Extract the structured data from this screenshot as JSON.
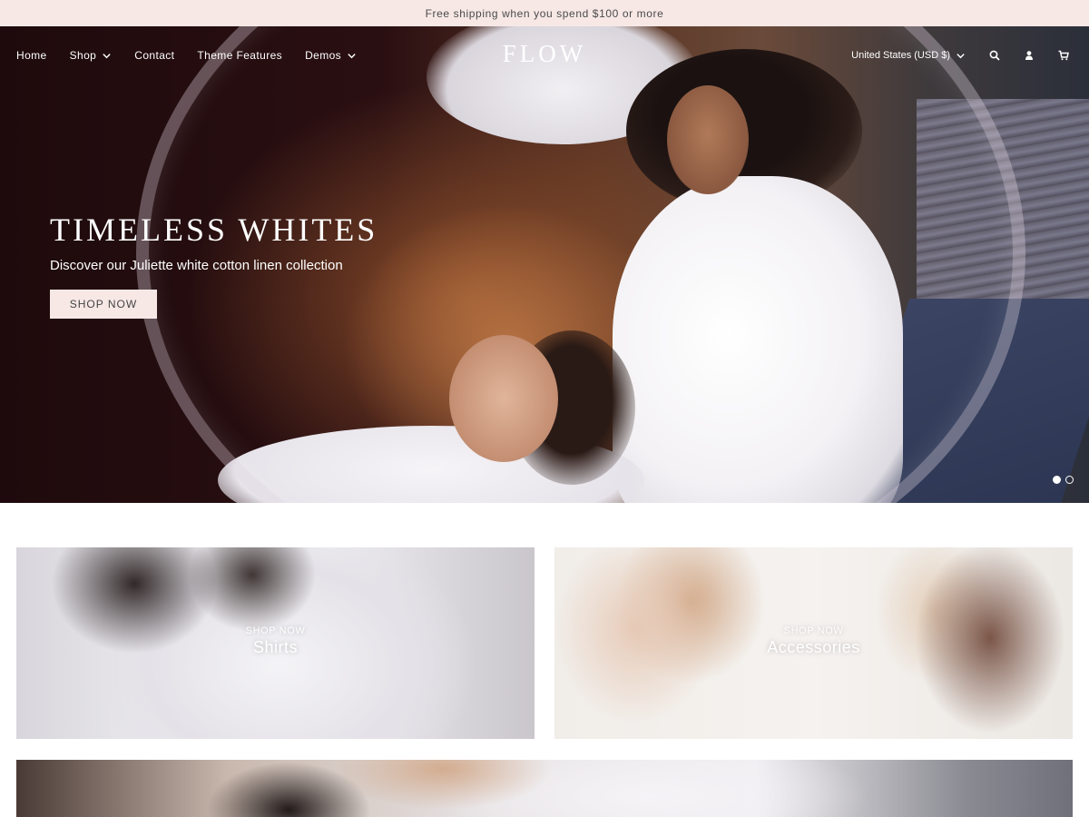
{
  "announcement": {
    "text": "Free shipping when you spend $100 or more"
  },
  "header": {
    "logo": "FLOW",
    "nav": [
      {
        "label": "Home",
        "has_dropdown": false
      },
      {
        "label": "Shop",
        "has_dropdown": true
      },
      {
        "label": "Contact",
        "has_dropdown": false
      },
      {
        "label": "Theme Features",
        "has_dropdown": false
      },
      {
        "label": "Demos",
        "has_dropdown": true
      }
    ],
    "currency": "United States (USD $)",
    "icons": [
      "search-icon",
      "account-icon",
      "cart-icon"
    ]
  },
  "hero": {
    "title": "TIMELESS WHITES",
    "subtitle": "Discover our Juliette white cotton linen collection",
    "button": "SHOP NOW",
    "slides": 2,
    "active_slide": 1
  },
  "collections": [
    {
      "kicker": "SHOP NOW",
      "name": "Shirts"
    },
    {
      "kicker": "SHOP NOW",
      "name": "Accessories"
    }
  ],
  "colors": {
    "announcement_bg": "#f7e8e6",
    "button_bg": "#f7e8e6",
    "header_text": "#ffffff"
  }
}
